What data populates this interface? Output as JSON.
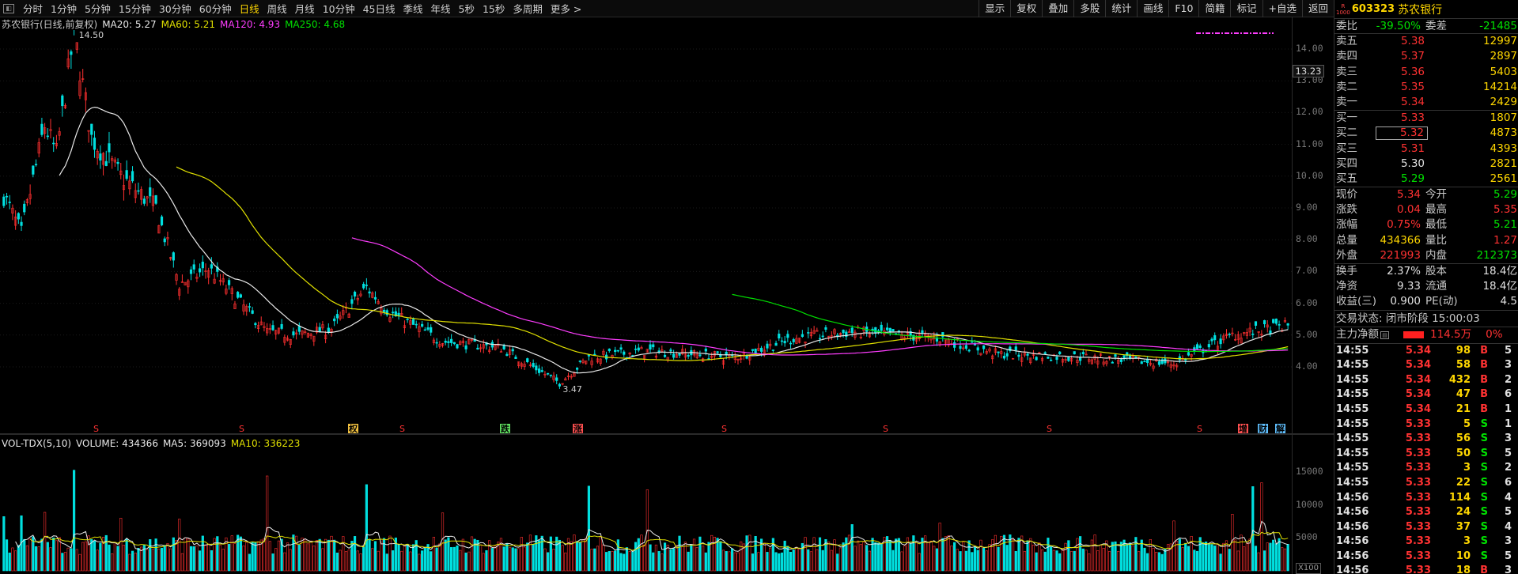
{
  "toolbar": {
    "periods": [
      "分时",
      "1分钟",
      "5分钟",
      "15分钟",
      "30分钟",
      "60分钟",
      "日线",
      "周线",
      "月线",
      "10分钟",
      "45日线",
      "季线",
      "年线",
      "5秒",
      "15秒",
      "多周期",
      "更多 >"
    ],
    "active_period": "日线",
    "right_buttons": [
      "显示",
      "复权",
      "叠加",
      "多股",
      "统计",
      "画线",
      "F10",
      "简籍",
      "标记",
      "+自选",
      "返回"
    ]
  },
  "chart": {
    "title": "苏农银行(日线,前复权)",
    "ma20": "MA20: 5.27",
    "ma60": "MA60: 5.21",
    "ma120": "MA120: 4.93",
    "ma250": "MA250: 4.68",
    "high_label": "14.50",
    "low_label": "3.47",
    "current_price": "13.23",
    "y_ticks": [
      "14.00",
      "13.00",
      "12.00",
      "11.00",
      "10.00",
      "9.00",
      "8.00",
      "7.00",
      "6.00",
      "5.00",
      "4.00"
    ],
    "annotations": [
      "S",
      "S",
      "权",
      "S",
      "跌",
      "涨",
      "S",
      "S",
      "S",
      "S",
      "增",
      "财",
      "解"
    ]
  },
  "volume": {
    "title": "VOL-TDX(5,10)",
    "volume": "VOLUME: 434366",
    "ma5": "MA5: 369093",
    "ma10": "MA10: 336223",
    "y_ticks": [
      "15000",
      "10000",
      "5000"
    ],
    "unit": "X100"
  },
  "panel": {
    "badge": "R\n1000",
    "code": "603323",
    "name": "苏农银行",
    "webi_label": "委比",
    "webi_value": "-39.50%",
    "weicha_label": "委差",
    "weicha_value": "-21485",
    "asks": [
      {
        "label": "卖五",
        "price": "5.38",
        "vol": "12997"
      },
      {
        "label": "卖四",
        "price": "5.37",
        "vol": "2897"
      },
      {
        "label": "卖三",
        "price": "5.36",
        "vol": "5403"
      },
      {
        "label": "卖二",
        "price": "5.35",
        "vol": "14214"
      },
      {
        "label": "卖一",
        "price": "5.34",
        "vol": "2429"
      }
    ],
    "bids": [
      {
        "label": "买一",
        "price": "5.33",
        "vol": "1807"
      },
      {
        "label": "买二",
        "price": "5.32",
        "vol": "4873"
      },
      {
        "label": "买三",
        "price": "5.31",
        "vol": "4393"
      },
      {
        "label": "买四",
        "price": "5.30",
        "vol": "2821"
      },
      {
        "label": "买五",
        "price": "5.29",
        "vol": "2561"
      }
    ],
    "stats1": [
      {
        "l": "现价",
        "v": "5.34",
        "l2": "今开",
        "v2": "5.29"
      },
      {
        "l": "涨跌",
        "v": "0.04",
        "l2": "最高",
        "v2": "5.35"
      },
      {
        "l": "涨幅",
        "v": "0.75%",
        "l2": "最低",
        "v2": "5.21"
      },
      {
        "l": "总量",
        "v": "434366",
        "l2": "量比",
        "v2": "1.27"
      },
      {
        "l": "外盘",
        "v": "221993",
        "l2": "内盘",
        "v2": "212373"
      }
    ],
    "stats2": [
      {
        "l": "换手",
        "v": "2.37%",
        "l2": "股本",
        "v2": "18.4亿"
      },
      {
        "l": "净资",
        "v": "9.33",
        "l2": "流通",
        "v2": "18.4亿"
      },
      {
        "l": "收益(三)",
        "v": "0.900",
        "l2": "PE(动)",
        "v2": "4.5"
      }
    ],
    "status": "交易状态: 闭市阶段 15:00:03",
    "mainforce_label": "主力净额",
    "mainforce_value": "114.5万",
    "mainforce_pct": "0%",
    "ticks": [
      {
        "t": "14:55",
        "p": "5.34",
        "v": "98",
        "s": "B",
        "n": "5"
      },
      {
        "t": "14:55",
        "p": "5.34",
        "v": "58",
        "s": "B",
        "n": "3"
      },
      {
        "t": "14:55",
        "p": "5.34",
        "v": "432",
        "s": "B",
        "n": "2"
      },
      {
        "t": "14:55",
        "p": "5.34",
        "v": "47",
        "s": "B",
        "n": "6"
      },
      {
        "t": "14:55",
        "p": "5.34",
        "v": "21",
        "s": "B",
        "n": "1"
      },
      {
        "t": "14:55",
        "p": "5.33",
        "v": "5",
        "s": "S",
        "n": "1"
      },
      {
        "t": "14:55",
        "p": "5.33",
        "v": "56",
        "s": "S",
        "n": "3"
      },
      {
        "t": "14:55",
        "p": "5.33",
        "v": "50",
        "s": "S",
        "n": "5"
      },
      {
        "t": "14:55",
        "p": "5.33",
        "v": "3",
        "s": "S",
        "n": "2"
      },
      {
        "t": "14:55",
        "p": "5.33",
        "v": "22",
        "s": "S",
        "n": "6"
      },
      {
        "t": "14:56",
        "p": "5.33",
        "v": "114",
        "s": "S",
        "n": "4"
      },
      {
        "t": "14:56",
        "p": "5.33",
        "v": "24",
        "s": "S",
        "n": "5"
      },
      {
        "t": "14:56",
        "p": "5.33",
        "v": "37",
        "s": "S",
        "n": "4"
      },
      {
        "t": "14:56",
        "p": "5.33",
        "v": "3",
        "s": "S",
        "n": "3"
      },
      {
        "t": "14:56",
        "p": "5.33",
        "v": "10",
        "s": "S",
        "n": "5"
      },
      {
        "t": "14:56",
        "p": "5.33",
        "v": "18",
        "s": "B",
        "n": "3"
      }
    ]
  }
}
